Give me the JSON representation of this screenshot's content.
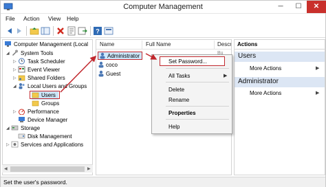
{
  "window": {
    "title": "Computer Management",
    "min_glyph": "─",
    "max_glyph": "☐",
    "close_glyph": "✕"
  },
  "menu": [
    "File",
    "Action",
    "View",
    "Help"
  ],
  "toolbar_icons": [
    "back-arrow-icon",
    "forward-arrow-icon",
    "folder-up-icon",
    "show-hide-tree-icon",
    "delete-icon",
    "properties-icon",
    "export-list-icon",
    "help-icon",
    "snapin-icon"
  ],
  "tree": {
    "root": "Computer Management (Local",
    "system_tools": "System Tools",
    "task_scheduler": "Task Scheduler",
    "event_viewer": "Event Viewer",
    "shared_folders": "Shared Folders",
    "local_users": "Local Users and Groups",
    "users": "Users",
    "groups": "Groups",
    "performance": "Performance",
    "device_manager": "Device Manager",
    "storage": "Storage",
    "disk_management": "Disk Management",
    "services": "Services and Applications"
  },
  "list": {
    "headers": [
      "Name",
      "Full Name",
      "Descr"
    ],
    "users": [
      "Administrator",
      "coco",
      "Guest"
    ],
    "cut_off_desc": "Bu"
  },
  "actions": {
    "title": "Actions",
    "sections": [
      {
        "label": "Users",
        "item": "More Actions"
      },
      {
        "label": "Administrator",
        "item": "More Actions"
      }
    ]
  },
  "context_menu": {
    "set_password": "Set Password...",
    "all_tasks": "All Tasks",
    "delete": "Delete",
    "rename": "Rename",
    "properties": "Properties",
    "help": "Help"
  },
  "status": "Set the user's password.",
  "colors": {
    "annotation_red": "#c1272d",
    "selection_blue": "#cce4f7",
    "section_bg": "#dce6f4"
  }
}
